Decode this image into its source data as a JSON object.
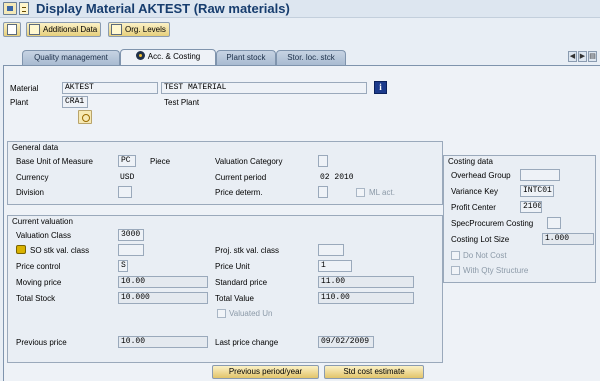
{
  "window": {
    "title": "Display Material AKTEST (Raw materials)"
  },
  "toolbar": {
    "additional_data_label": "Additional Data",
    "org_levels_label": "Org. Levels"
  },
  "tabs": [
    {
      "label": "Quality management"
    },
    {
      "label": "Acc. & Costing"
    },
    {
      "label": "Plant stock"
    },
    {
      "label": "Stor. loc. stck"
    }
  ],
  "header": {
    "material_label": "Material",
    "material_value": "AKTEST",
    "material_description": "TEST MATERIAL",
    "plant_label": "Plant",
    "plant_value": "CRA1",
    "plant_description": "Test Plant"
  },
  "general": {
    "title": "General data",
    "base_uom_label": "Base Unit of Measure",
    "base_uom_value": "PC",
    "base_uom_text": "Piece",
    "valuation_category_label": "Valuation Category",
    "currency_label": "Currency",
    "currency_value": "USD",
    "current_period_label": "Current period",
    "current_period_value": "02 2010",
    "division_label": "Division",
    "price_determ_label": "Price determ.",
    "ml_act_label": "ML act."
  },
  "valuation": {
    "title": "Current valuation",
    "valuation_class_label": "Valuation Class",
    "valuation_class_value": "3000",
    "so_stk_label": "SO stk val. class",
    "proj_stk_label": "Proj. stk val. class",
    "price_control_label": "Price control",
    "price_control_value": "S",
    "price_unit_label": "Price Unit",
    "price_unit_value": "1",
    "moving_price_label": "Moving price",
    "moving_price_value": "10.00",
    "standard_price_label": "Standard price",
    "standard_price_value": "11.00",
    "total_stock_label": "Total Stock",
    "total_stock_value": "10.000",
    "total_value_label": "Total Value",
    "total_value_value": "110.00",
    "valuated_un_label": "Valuated Un",
    "previous_price_label": "Previous price",
    "previous_price_value": "10.00",
    "last_price_change_label": "Last price change",
    "last_price_change_value": "09/02/2009"
  },
  "costing": {
    "title": "Costing data",
    "overhead_group_label": "Overhead Group",
    "variance_key_label": "Variance Key",
    "variance_key_value": "INTC01",
    "profit_center_label": "Profit Center",
    "profit_center_value": "2100",
    "spec_procurem_label": "SpecProcurem Costing",
    "costing_lot_size_label": "Costing Lot Size",
    "costing_lot_size_value": "1.000",
    "do_not_cost_label": "Do Not Cost",
    "with_qty_structure_label": "With Qty Structure"
  },
  "buttons": {
    "previous_period_label": "Previous period/year",
    "std_cost_estimate_label": "Std cost estimate"
  }
}
